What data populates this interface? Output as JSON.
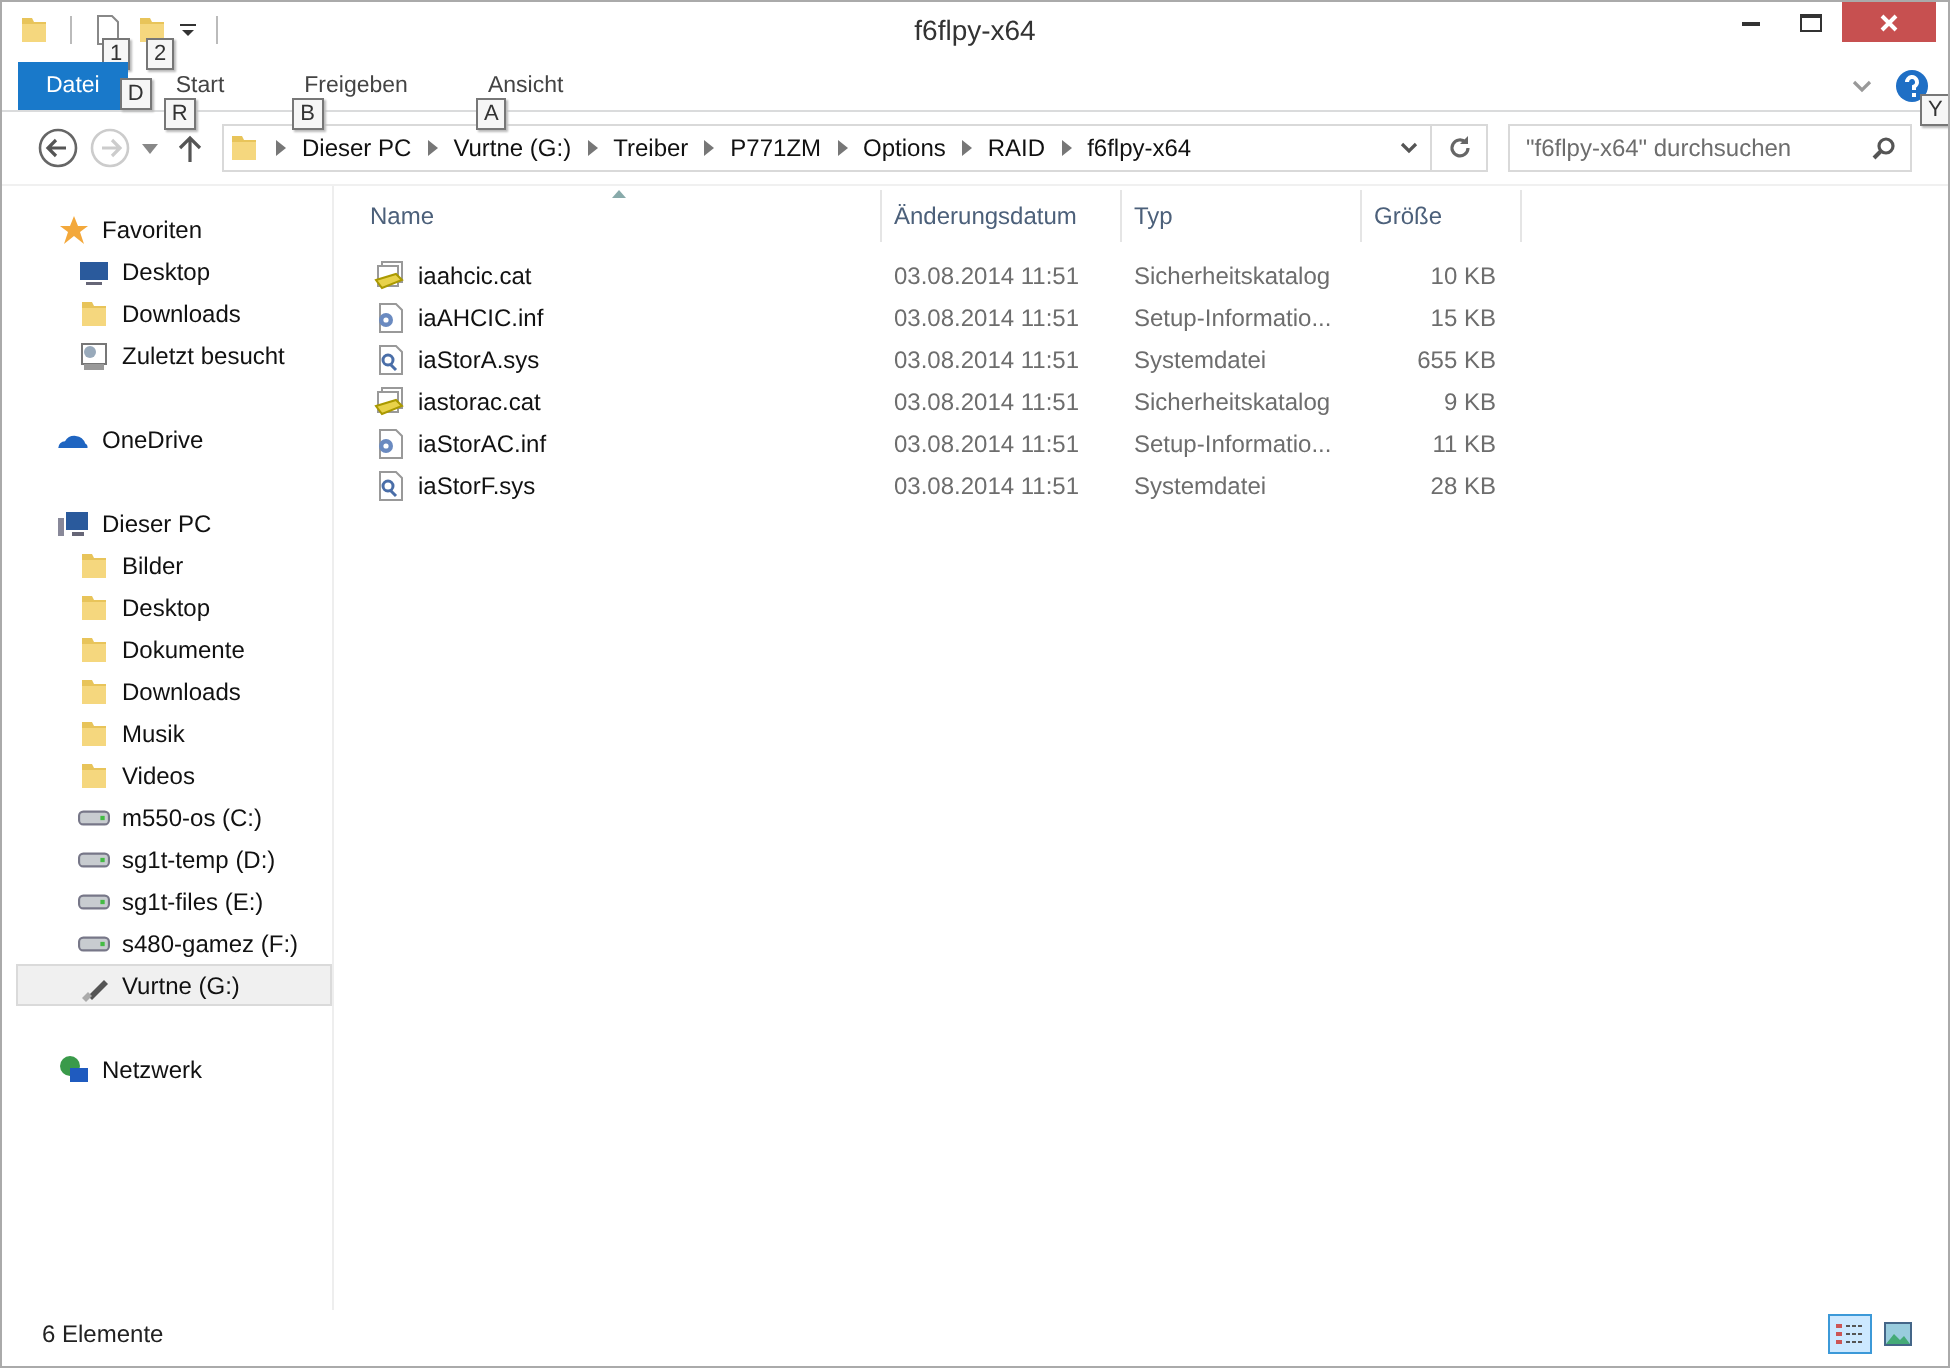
{
  "window": {
    "title": "f6flpy-x64"
  },
  "quick_access": [
    {
      "key_tip": "1"
    },
    {
      "key_tip": "2"
    }
  ],
  "ribbon": {
    "tabs": [
      {
        "label": "Datei",
        "key_tip": "D",
        "kind": "file",
        "selected": false
      },
      {
        "label": "Start",
        "key_tip": "R",
        "kind": "tab",
        "selected": false
      },
      {
        "label": "Freigeben",
        "key_tip": "B",
        "kind": "tab",
        "selected": false
      },
      {
        "label": "Ansicht",
        "key_tip": "A",
        "kind": "tab",
        "selected": false
      }
    ],
    "help_key_tip": "Y"
  },
  "address_bar": {
    "path": [
      "Dieser PC",
      "Vurtne (G:)",
      "Treiber",
      "P771ZM",
      "Options",
      "RAID",
      "f6flpy-x64"
    ]
  },
  "search": {
    "placeholder": "\"f6flpy-x64\" durchsuchen"
  },
  "sidebar": {
    "groups": [
      {
        "label": "Favoriten",
        "kind": "star",
        "children": [
          {
            "label": "Desktop",
            "kind": "monitor",
            "selected": false
          },
          {
            "label": "Downloads",
            "kind": "folder",
            "selected": false
          },
          {
            "label": "Zuletzt besucht",
            "kind": "recent",
            "selected": false
          }
        ]
      },
      {
        "label": "OneDrive",
        "kind": "cloud"
      },
      {
        "label": "Dieser PC",
        "kind": "pc",
        "children": [
          {
            "label": "Bilder",
            "kind": "folder",
            "selected": false
          },
          {
            "label": "Desktop",
            "kind": "folder",
            "selected": false
          },
          {
            "label": "Dokumente",
            "kind": "folder",
            "selected": false
          },
          {
            "label": "Downloads",
            "kind": "folder",
            "selected": false
          },
          {
            "label": "Musik",
            "kind": "folder",
            "selected": false
          },
          {
            "label": "Videos",
            "kind": "folder",
            "selected": false
          },
          {
            "label": "m550-os (C:)",
            "kind": "drive",
            "selected": false
          },
          {
            "label": "sg1t-temp (D:)",
            "kind": "drive",
            "selected": false
          },
          {
            "label": "sg1t-files (E:)",
            "kind": "drive",
            "selected": false
          },
          {
            "label": "s480-gamez (F:)",
            "kind": "drive",
            "selected": false
          },
          {
            "label": "Vurtne (G:)",
            "kind": "usb",
            "selected": true
          }
        ]
      },
      {
        "label": "Netzwerk",
        "kind": "network"
      }
    ]
  },
  "table": {
    "columns": [
      "Name",
      "Änderungsdatum",
      "Typ",
      "Größe"
    ],
    "rows": [
      {
        "kind": "cat",
        "name": "iaahcic.cat",
        "date": "03.08.2014 11:51",
        "type": "Sicherheitskatalog",
        "size": "10 KB"
      },
      {
        "kind": "inf",
        "name": "iaAHCIC.inf",
        "date": "03.08.2014 11:51",
        "type": "Setup-Informatio...",
        "size": "15 KB"
      },
      {
        "kind": "sys",
        "name": "iaStorA.sys",
        "date": "03.08.2014 11:51",
        "type": "Systemdatei",
        "size": "655 KB"
      },
      {
        "kind": "cat",
        "name": "iastorac.cat",
        "date": "03.08.2014 11:51",
        "type": "Sicherheitskatalog",
        "size": "9 KB"
      },
      {
        "kind": "inf",
        "name": "iaStorAC.inf",
        "date": "03.08.2014 11:51",
        "type": "Setup-Informatio...",
        "size": "11 KB"
      },
      {
        "kind": "sys",
        "name": "iaStorF.sys",
        "date": "03.08.2014 11:51",
        "type": "Systemdatei",
        "size": "28 KB"
      }
    ]
  },
  "status_bar": {
    "count": "6 Elemente",
    "views": [
      {
        "kind": "details",
        "selected": true
      },
      {
        "kind": "large",
        "selected": false
      }
    ]
  }
}
